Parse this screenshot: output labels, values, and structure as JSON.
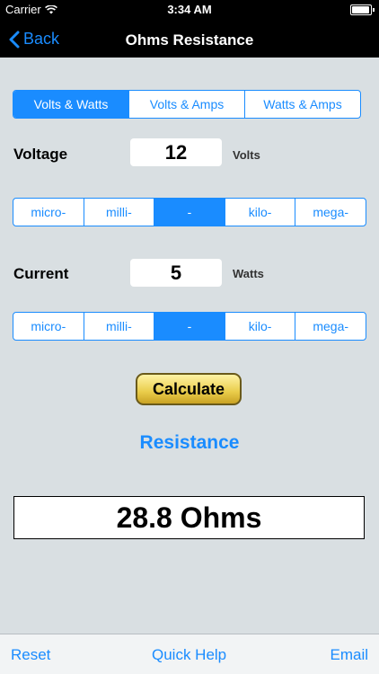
{
  "status": {
    "carrier": "Carrier",
    "time": "3:34 AM"
  },
  "nav": {
    "back_label": "Back",
    "title": "Ohms Resistance"
  },
  "mode_tabs": [
    "Volts & Watts",
    "Volts & Amps",
    "Watts & Amps"
  ],
  "mode_selected": 0,
  "voltage": {
    "label": "Voltage",
    "value": "12",
    "unit": "Volts",
    "prefixes": [
      "micro-",
      "milli-",
      "-",
      "kilo-",
      "mega-"
    ],
    "selected": 2
  },
  "current": {
    "label": "Current",
    "value": "5",
    "unit": "Watts",
    "prefixes": [
      "micro-",
      "milli-",
      "-",
      "kilo-",
      "mega-"
    ],
    "selected": 2
  },
  "calculate_label": "Calculate",
  "result": {
    "label": "Resistance",
    "value": "28.8 Ohms"
  },
  "toolbar": {
    "reset": "Reset",
    "help": "Quick Help",
    "email": "Email"
  },
  "colors": {
    "accent": "#1a8cff",
    "background": "#d9dfe2"
  }
}
